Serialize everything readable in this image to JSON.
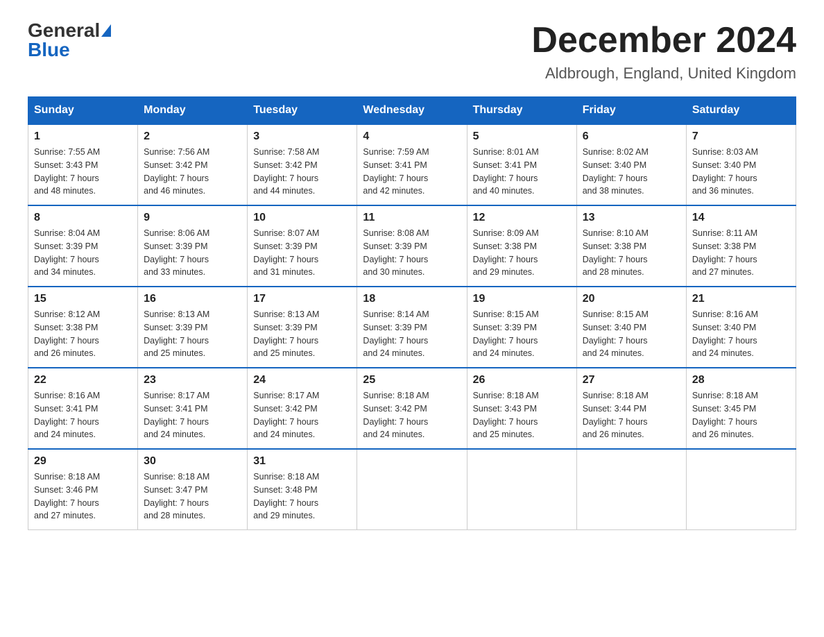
{
  "logo": {
    "general": "General",
    "blue": "Blue"
  },
  "title": {
    "month_year": "December 2024",
    "location": "Aldbrough, England, United Kingdom"
  },
  "weekdays": [
    "Sunday",
    "Monday",
    "Tuesday",
    "Wednesday",
    "Thursday",
    "Friday",
    "Saturday"
  ],
  "weeks": [
    [
      {
        "day": "1",
        "sunrise": "7:55 AM",
        "sunset": "3:43 PM",
        "daylight": "7 hours and 48 minutes."
      },
      {
        "day": "2",
        "sunrise": "7:56 AM",
        "sunset": "3:42 PM",
        "daylight": "7 hours and 46 minutes."
      },
      {
        "day": "3",
        "sunrise": "7:58 AM",
        "sunset": "3:42 PM",
        "daylight": "7 hours and 44 minutes."
      },
      {
        "day": "4",
        "sunrise": "7:59 AM",
        "sunset": "3:41 PM",
        "daylight": "7 hours and 42 minutes."
      },
      {
        "day": "5",
        "sunrise": "8:01 AM",
        "sunset": "3:41 PM",
        "daylight": "7 hours and 40 minutes."
      },
      {
        "day": "6",
        "sunrise": "8:02 AM",
        "sunset": "3:40 PM",
        "daylight": "7 hours and 38 minutes."
      },
      {
        "day": "7",
        "sunrise": "8:03 AM",
        "sunset": "3:40 PM",
        "daylight": "7 hours and 36 minutes."
      }
    ],
    [
      {
        "day": "8",
        "sunrise": "8:04 AM",
        "sunset": "3:39 PM",
        "daylight": "7 hours and 34 minutes."
      },
      {
        "day": "9",
        "sunrise": "8:06 AM",
        "sunset": "3:39 PM",
        "daylight": "7 hours and 33 minutes."
      },
      {
        "day": "10",
        "sunrise": "8:07 AM",
        "sunset": "3:39 PM",
        "daylight": "7 hours and 31 minutes."
      },
      {
        "day": "11",
        "sunrise": "8:08 AM",
        "sunset": "3:39 PM",
        "daylight": "7 hours and 30 minutes."
      },
      {
        "day": "12",
        "sunrise": "8:09 AM",
        "sunset": "3:38 PM",
        "daylight": "7 hours and 29 minutes."
      },
      {
        "day": "13",
        "sunrise": "8:10 AM",
        "sunset": "3:38 PM",
        "daylight": "7 hours and 28 minutes."
      },
      {
        "day": "14",
        "sunrise": "8:11 AM",
        "sunset": "3:38 PM",
        "daylight": "7 hours and 27 minutes."
      }
    ],
    [
      {
        "day": "15",
        "sunrise": "8:12 AM",
        "sunset": "3:38 PM",
        "daylight": "7 hours and 26 minutes."
      },
      {
        "day": "16",
        "sunrise": "8:13 AM",
        "sunset": "3:39 PM",
        "daylight": "7 hours and 25 minutes."
      },
      {
        "day": "17",
        "sunrise": "8:13 AM",
        "sunset": "3:39 PM",
        "daylight": "7 hours and 25 minutes."
      },
      {
        "day": "18",
        "sunrise": "8:14 AM",
        "sunset": "3:39 PM",
        "daylight": "7 hours and 24 minutes."
      },
      {
        "day": "19",
        "sunrise": "8:15 AM",
        "sunset": "3:39 PM",
        "daylight": "7 hours and 24 minutes."
      },
      {
        "day": "20",
        "sunrise": "8:15 AM",
        "sunset": "3:40 PM",
        "daylight": "7 hours and 24 minutes."
      },
      {
        "day": "21",
        "sunrise": "8:16 AM",
        "sunset": "3:40 PM",
        "daylight": "7 hours and 24 minutes."
      }
    ],
    [
      {
        "day": "22",
        "sunrise": "8:16 AM",
        "sunset": "3:41 PM",
        "daylight": "7 hours and 24 minutes."
      },
      {
        "day": "23",
        "sunrise": "8:17 AM",
        "sunset": "3:41 PM",
        "daylight": "7 hours and 24 minutes."
      },
      {
        "day": "24",
        "sunrise": "8:17 AM",
        "sunset": "3:42 PM",
        "daylight": "7 hours and 24 minutes."
      },
      {
        "day": "25",
        "sunrise": "8:18 AM",
        "sunset": "3:42 PM",
        "daylight": "7 hours and 24 minutes."
      },
      {
        "day": "26",
        "sunrise": "8:18 AM",
        "sunset": "3:43 PM",
        "daylight": "7 hours and 25 minutes."
      },
      {
        "day": "27",
        "sunrise": "8:18 AM",
        "sunset": "3:44 PM",
        "daylight": "7 hours and 26 minutes."
      },
      {
        "day": "28",
        "sunrise": "8:18 AM",
        "sunset": "3:45 PM",
        "daylight": "7 hours and 26 minutes."
      }
    ],
    [
      {
        "day": "29",
        "sunrise": "8:18 AM",
        "sunset": "3:46 PM",
        "daylight": "7 hours and 27 minutes."
      },
      {
        "day": "30",
        "sunrise": "8:18 AM",
        "sunset": "3:47 PM",
        "daylight": "7 hours and 28 minutes."
      },
      {
        "day": "31",
        "sunrise": "8:18 AM",
        "sunset": "3:48 PM",
        "daylight": "7 hours and 29 minutes."
      },
      null,
      null,
      null,
      null
    ]
  ],
  "labels": {
    "sunrise": "Sunrise:",
    "sunset": "Sunset:",
    "daylight": "Daylight:"
  }
}
